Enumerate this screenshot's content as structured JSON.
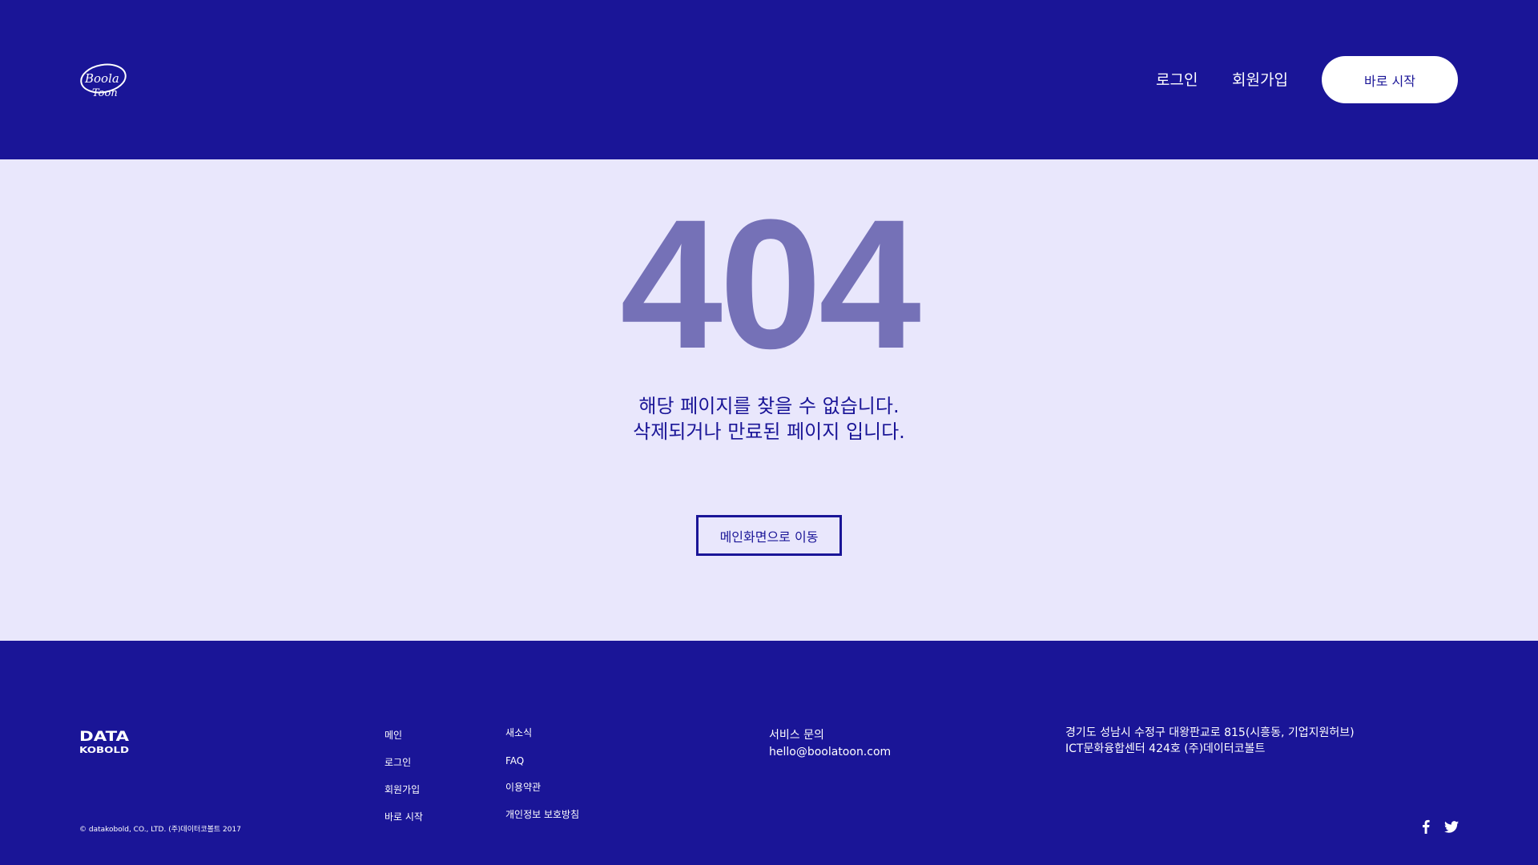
{
  "header": {
    "logo_alt": "Boola Toon",
    "nav": {
      "login": "로그인",
      "signup": "회원가입"
    },
    "start_button": "바로 시작"
  },
  "main": {
    "error_code": "404",
    "message_line1": "해당 페이지를 찾을 수 없습니다.",
    "message_line2": "삭제되거나 만료된 페이지 입니다.",
    "home_button": "메인화면으로 이동"
  },
  "footer": {
    "logo_top": "DATA",
    "logo_bottom": "KOBOLD",
    "copyright": "© datakobold, CO., LTD. (주)데이터코볼트 2017",
    "nav_col1": [
      "메인",
      "로그인",
      "회원가입",
      "바로 시작"
    ],
    "nav_col2": [
      "새소식",
      "FAQ",
      "이용약관",
      "개인정보 보호방침"
    ],
    "contact_title": "서비스 문의",
    "contact_email": "hello@boolatoon.com",
    "address_line1": "경기도 성남시 수정구 대왕판교로 815(시흥동, 기업지원허브)",
    "address_line2": "ICT문화융합센터 424호 (주)데이터코볼트",
    "social": [
      "facebook-icon",
      "twitter-icon"
    ]
  },
  "colors": {
    "primary": "#1a1597",
    "background": "#e9e7fc",
    "error_code": "#7571b7",
    "white": "#ffffff"
  }
}
